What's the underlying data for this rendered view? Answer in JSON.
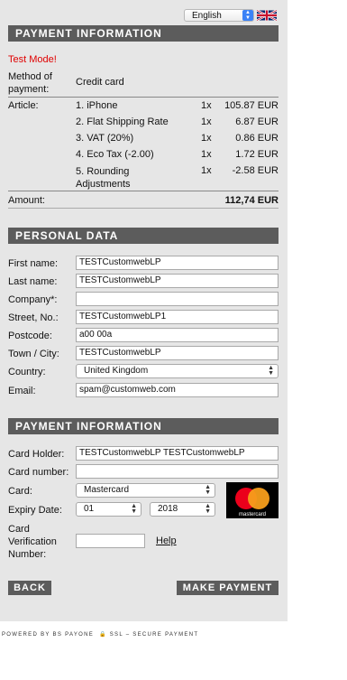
{
  "language": {
    "selected": "English"
  },
  "payment_section": {
    "title": "PAYMENT INFORMATION",
    "test_mode": "Test Mode!",
    "method_label": "Method of payment:",
    "method_label_line1": "Method of",
    "method_label_line2": "payment:",
    "method_value": "Credit card",
    "article_label": "Article:",
    "articles": [
      {
        "name": "1. iPhone",
        "qty": "1x",
        "price": "105.87 EUR"
      },
      {
        "name": "2. Flat Shipping Rate",
        "qty": "1x",
        "price": "6.87 EUR"
      },
      {
        "name": "3. VAT (20%)",
        "qty": "1x",
        "price": "0.86 EUR"
      },
      {
        "name": "4. Eco Tax (-2.00)",
        "qty": "1x",
        "price": "1.72 EUR"
      },
      {
        "name": "5. Rounding Adjustments",
        "name_line1": "5. Rounding",
        "name_line2": "Adjustments",
        "qty": "1x",
        "price": "-2.58 EUR"
      }
    ],
    "amount_label": "Amount:",
    "amount_value": "112,74 EUR"
  },
  "personal_section": {
    "title": "PERSONAL DATA",
    "fields": {
      "first_name": {
        "label": "First name:",
        "value": "TESTCustomwebLP"
      },
      "last_name": {
        "label": "Last name:",
        "value": "TESTCustomwebLP"
      },
      "company": {
        "label": "Company*:",
        "value": ""
      },
      "street": {
        "label": "Street, No.:",
        "value": "TESTCustomwebLP1"
      },
      "postcode": {
        "label": "Postcode:",
        "value": "a00 00a"
      },
      "town": {
        "label": "Town / City:",
        "value": "TESTCustomwebLP"
      },
      "country": {
        "label": "Country:",
        "value": "United Kingdom"
      },
      "email": {
        "label": "Email:",
        "value": "spam@customweb.com"
      }
    }
  },
  "card_section": {
    "title": "PAYMENT INFORMATION",
    "holder": {
      "label": "Card Holder:",
      "value": "TESTCustomwebLP TESTCustomwebLP"
    },
    "number": {
      "label": "Card number:",
      "value": ""
    },
    "card": {
      "label": "Card:",
      "value": "Mastercard"
    },
    "expiry": {
      "label": "Expiry Date:",
      "month": "01",
      "year": "2018"
    },
    "cvn": {
      "label": "Card Verification Number:",
      "line1": "Card",
      "line2": "Verification",
      "line3": "Number:",
      "value": ""
    },
    "help_link": "Help",
    "card_logo_text": "mastercard"
  },
  "buttons": {
    "back": "BACK",
    "pay": "MAKE PAYMENT"
  },
  "footer": {
    "powered": "POWERED BY BS PAYONE",
    "ssl": "SSL – SECURE PAYMENT"
  },
  "colors": {
    "section_bar": "#5c5c5c",
    "panel": "#e6e6e6",
    "test_mode": "#e00000",
    "mc_red": "#eb001b",
    "mc_orange": "#f79e1b"
  }
}
